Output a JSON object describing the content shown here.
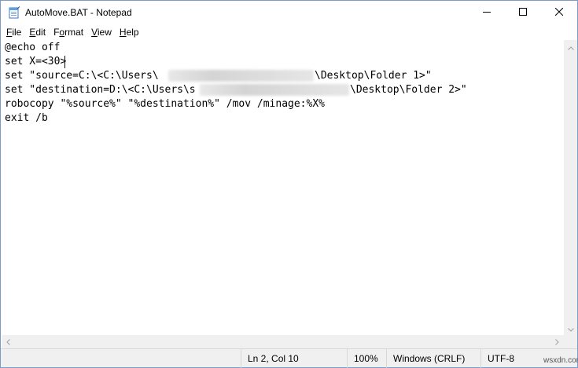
{
  "window": {
    "title": "AutoMove.BAT - Notepad",
    "icons": {
      "app": "notepad-icon",
      "minimize": "minimize-icon",
      "maximize": "maximize-icon",
      "close": "close-icon"
    }
  },
  "menu": {
    "file": {
      "mn": "F",
      "rest": "ile"
    },
    "edit": {
      "mn": "E",
      "rest": "dit"
    },
    "format": {
      "pre": "F",
      "mn": "o",
      "rest": "rmat"
    },
    "view": {
      "mn": "V",
      "rest": "iew"
    },
    "help": {
      "mn": "H",
      "rest": "elp"
    }
  },
  "editor": {
    "lines": [
      "@echo off",
      "set X=<30>",
      "set \"source=C:\\<C:\\Users\\",
      "\\Desktop\\Folder 1>\"",
      "set \"destination=D:\\<C:\\Users\\s",
      "\\Desktop\\Folder 2>\"",
      "robocopy \"%source%\" \"%destination%\" /mov /minage:%X%",
      "exit /b"
    ]
  },
  "status": {
    "position": "Ln 2, Col 10",
    "zoom": "100%",
    "line_endings": "Windows (CRLF)",
    "encoding": "UTF-8"
  },
  "watermark": "wsxdn.com"
}
